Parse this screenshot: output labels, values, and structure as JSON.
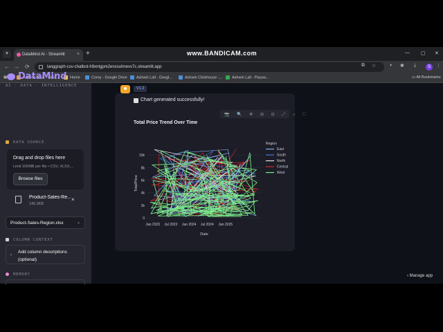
{
  "browser": {
    "overlay_watermark": "www.BANDICAM.com",
    "tab": {
      "title": "DataMind AI - Streamlit",
      "close": "×"
    },
    "new_tab": "+",
    "window_controls": [
      "—",
      "▢",
      "✕"
    ],
    "nav": [
      "←",
      "→",
      "⟳"
    ],
    "url": "langgraph-csv-chatbot-h9xntgpm2enxsuhnevv7c.streamlit.app",
    "bookmarks": [
      {
        "label": "Aneesh Arun - Goo...",
        "color": "#e8a04a"
      },
      {
        "label": "Home",
        "color": "#f2c94c"
      },
      {
        "label": "Corey - Google Drive",
        "color": "#4a90d9"
      },
      {
        "label": "Ashwin Lall - Googl...",
        "color": "#4a90d9"
      },
      {
        "label": "Ashwin Clickhouse -...",
        "color": "#4a90d9"
      },
      {
        "label": "Ashwin Lall - Passw...",
        "color": "#34a853"
      }
    ],
    "all_bookmarks": "All Bookmarks",
    "profile_initial": "S"
  },
  "sidebar": {
    "brand": "DataMind",
    "tagline": "AI · DATA · INTELLIGENCE",
    "data_source_header": "DATA SOURCE",
    "dropzone": {
      "title": "Drag and drop files here",
      "subtitle": "Limit 200MB per file • CSV, XLSX,...",
      "browse_label": "Browse files"
    },
    "file": {
      "name": "Product-Sales-Re...",
      "size": "146.2KB",
      "remove": "×"
    },
    "selected_sheet": "Product-Sales-Region.xlsx",
    "column_context_header": "COLUMN CONTEXT",
    "column_descriptions_label": "Add column descriptions (optional)",
    "memory_header": "MEMORY"
  },
  "main": {
    "avatar_icon": "☻",
    "version_badge": "V1.2",
    "status": "Chart generated successfully!",
    "modebar": "📷 🔍 ✥ ⊞ ⊟ ⤢ ⌂ ⛶"
  },
  "chart_data": {
    "type": "line",
    "title": "Total Price Trend Over Time",
    "xlabel": "Date",
    "ylabel": "TotalPrice",
    "x_ticks": [
      "Jan 2023",
      "Jul 2023",
      "Jan 2024",
      "Jul 2024",
      "Jan 2025"
    ],
    "y_ticks": [
      "0",
      "2k",
      "4k",
      "6k",
      "8k",
      "10k"
    ],
    "xlim": [
      "2022-11-01",
      "2025-12-31"
    ],
    "ylim": [
      0,
      11000
    ],
    "legend_title": "Region",
    "legend_position": "right",
    "series": [
      {
        "name": "East",
        "color": "#8ab4f8"
      },
      {
        "name": "South",
        "color": "#4a7bd8"
      },
      {
        "name": "North",
        "color": "#e8e8f0"
      },
      {
        "name": "Central",
        "color": "#d62828"
      },
      {
        "name": "West",
        "color": "#7cf08a"
      }
    ]
  },
  "footer": {
    "manage_app": "Manage app"
  }
}
